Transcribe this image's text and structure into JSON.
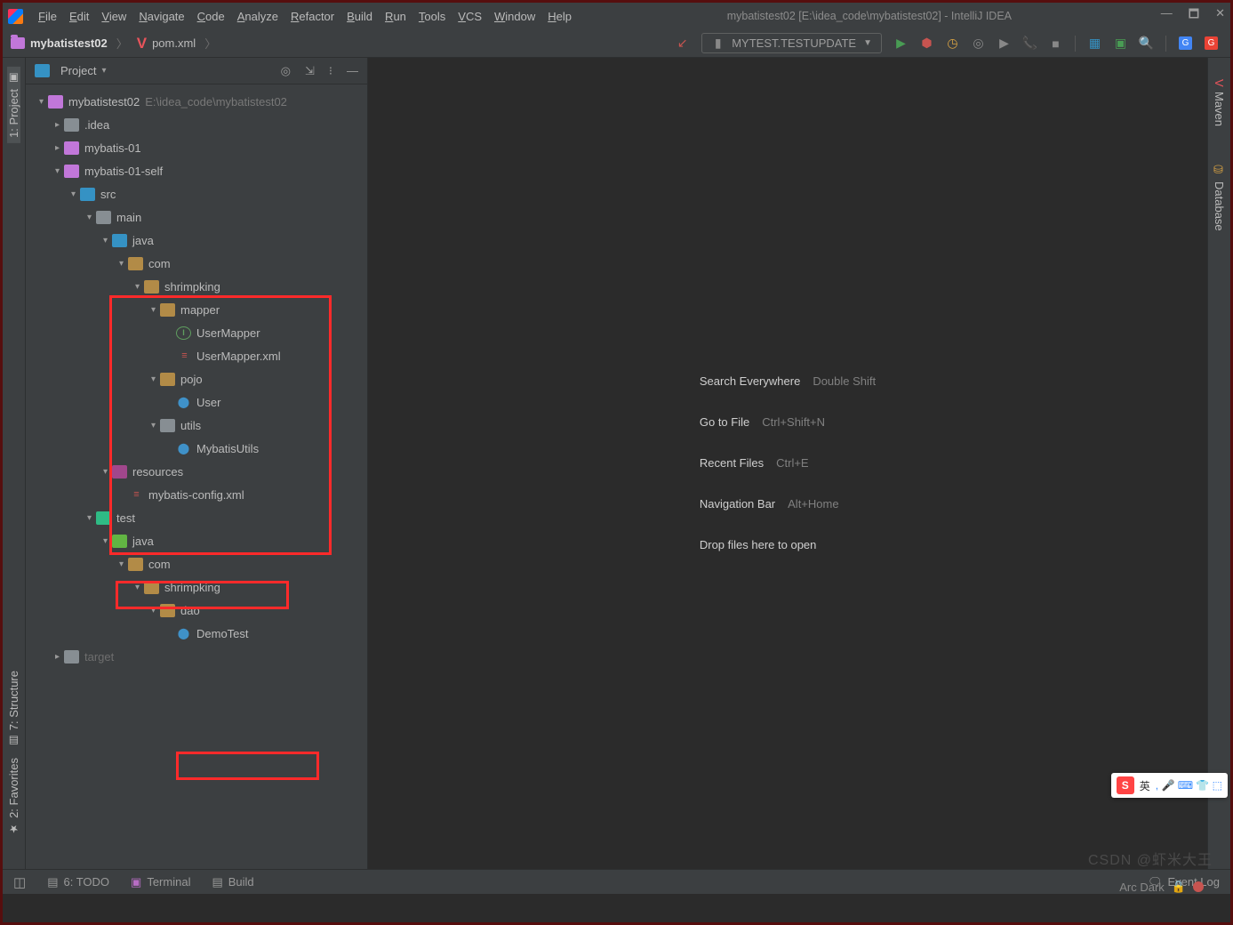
{
  "window": {
    "title": "mybatistest02 [E:\\idea_code\\mybatistest02] - IntelliJ IDEA"
  },
  "menu": [
    "File",
    "Edit",
    "View",
    "Navigate",
    "Code",
    "Analyze",
    "Refactor",
    "Build",
    "Run",
    "Tools",
    "VCS",
    "Window",
    "Help"
  ],
  "crumb": {
    "root": "mybatistest02",
    "file": "pom.xml"
  },
  "runcfg": {
    "label": "MYTEST.TESTUPDATE"
  },
  "panel": {
    "title": "Project"
  },
  "tree": [
    {
      "d": 0,
      "a": "down",
      "icon": "i-folder-p",
      "label": "mybatistest02",
      "path": "E:\\idea_code\\mybatistest02"
    },
    {
      "d": 1,
      "a": "right",
      "icon": "i-folder",
      "label": ".idea"
    },
    {
      "d": 1,
      "a": "right",
      "icon": "i-folder-p",
      "label": "mybatis-01"
    },
    {
      "d": 1,
      "a": "down",
      "icon": "i-folder-p",
      "label": "mybatis-01-self"
    },
    {
      "d": 2,
      "a": "down",
      "icon": "i-folder-b",
      "label": "src"
    },
    {
      "d": 3,
      "a": "down",
      "icon": "i-folder",
      "label": "main"
    },
    {
      "d": 4,
      "a": "down",
      "icon": "i-folder-b",
      "label": "java"
    },
    {
      "d": 5,
      "a": "down",
      "icon": "i-pkg",
      "label": "com"
    },
    {
      "d": 6,
      "a": "down",
      "icon": "i-pkg",
      "label": "shrimpking"
    },
    {
      "d": 7,
      "a": "down",
      "icon": "i-pkg",
      "label": "mapper"
    },
    {
      "d": 8,
      "a": "none",
      "icon": "i-int",
      "label": "UserMapper"
    },
    {
      "d": 8,
      "a": "none",
      "icon": "i-xml",
      "label": "UserMapper.xml",
      "xmlico": "≡"
    },
    {
      "d": 7,
      "a": "down",
      "icon": "i-pkg",
      "label": "pojo"
    },
    {
      "d": 8,
      "a": "none",
      "icon": "i-cls",
      "label": "User"
    },
    {
      "d": 7,
      "a": "down",
      "icon": "i-folder",
      "label": "utils"
    },
    {
      "d": 8,
      "a": "none",
      "icon": "i-cls",
      "label": "MybatisUtils"
    },
    {
      "d": 4,
      "a": "down",
      "icon": "i-folder-r",
      "label": "resources"
    },
    {
      "d": 5,
      "a": "none",
      "icon": "i-xml",
      "label": "mybatis-config.xml",
      "xmlico": "≡"
    },
    {
      "d": 3,
      "a": "down",
      "icon": "i-folder-t",
      "label": "test"
    },
    {
      "d": 4,
      "a": "down",
      "icon": "i-folder-g",
      "label": "java"
    },
    {
      "d": 5,
      "a": "down",
      "icon": "i-pkg",
      "label": "com"
    },
    {
      "d": 6,
      "a": "down",
      "icon": "i-pkg",
      "label": "shrimpking"
    },
    {
      "d": 7,
      "a": "down",
      "icon": "i-pkg",
      "label": "dao"
    },
    {
      "d": 8,
      "a": "none",
      "icon": "i-cls",
      "label": "DemoTest"
    },
    {
      "d": 1,
      "a": "right",
      "icon": "i-folder",
      "label": "target",
      "faded": true
    }
  ],
  "tips": [
    {
      "label": "Search Everywhere",
      "key": "Double Shift"
    },
    {
      "label": "Go to File",
      "key": "Ctrl+Shift+N"
    },
    {
      "label": "Recent Files",
      "key": "Ctrl+E"
    },
    {
      "label": "Navigation Bar",
      "key": "Alt+Home"
    }
  ],
  "drop": "Drop files here to open",
  "sidebars": {
    "left": [
      "1: Project"
    ],
    "leftBottom": [
      "7: Structure",
      "2: Favorites"
    ],
    "right": [
      "Maven",
      "Database"
    ]
  },
  "status": {
    "todo": "6: TODO",
    "terminal": "Terminal",
    "build": "Build",
    "eventlog": "Event Log",
    "theme": "Arc Dark"
  },
  "tray": {
    "ime": "英"
  },
  "watermark": "CSDN @虾米大王"
}
